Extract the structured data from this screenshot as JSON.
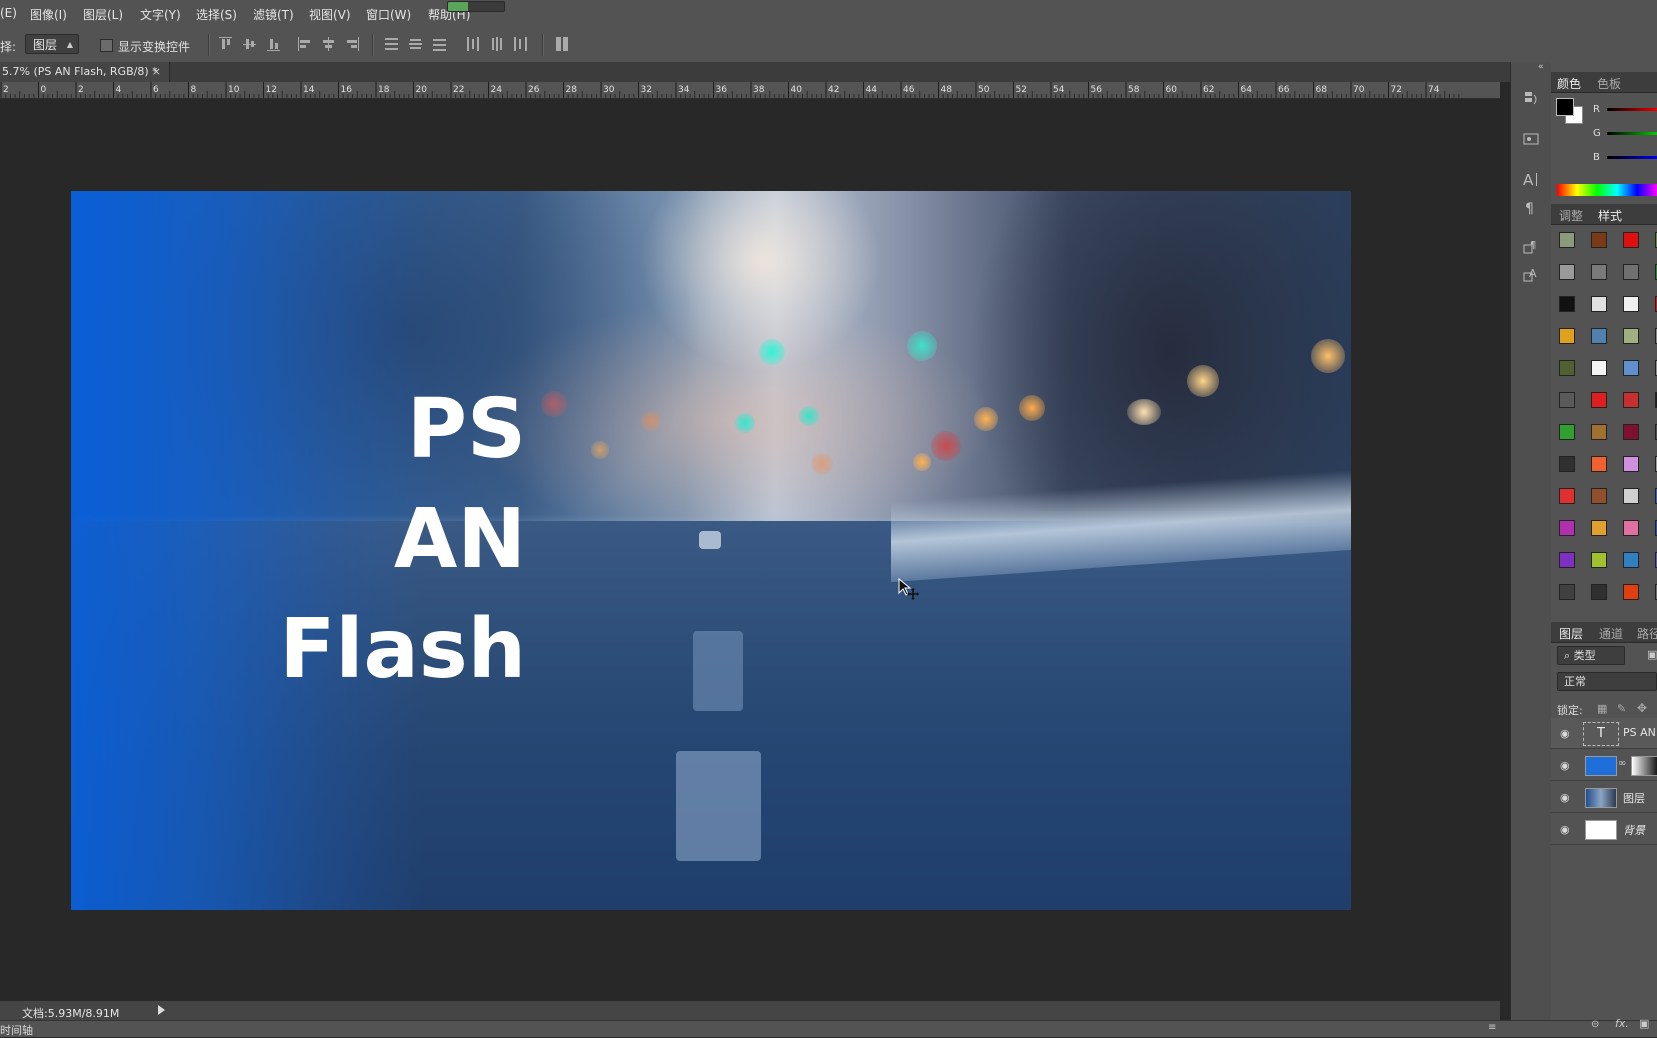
{
  "menu": {
    "items": [
      {
        "label": "(E)",
        "x_hint": "edit"
      },
      {
        "label": "图像(I)"
      },
      {
        "label": "图层(L)"
      },
      {
        "label": "文字(Y)"
      },
      {
        "label": "选择(S)"
      },
      {
        "label": "滤镜(T)"
      },
      {
        "label": "视图(V)"
      },
      {
        "label": "窗口(W)"
      },
      {
        "label": "帮助(H)"
      }
    ],
    "progress": 0.35
  },
  "options": {
    "select_prefix": "择:",
    "select_value": "图层",
    "transform_label": "显示变换控件"
  },
  "document": {
    "tab_title": "5.7% (PS AN Flash, RGB/8) *",
    "close": "×",
    "ruler_ticks": [
      "2",
      "0",
      "2",
      "4",
      "6",
      "8",
      "10",
      "12",
      "14",
      "16",
      "18",
      "20",
      "22",
      "24",
      "26",
      "28",
      "30",
      "32",
      "34",
      "36",
      "38",
      "40",
      "42",
      "44",
      "46",
      "48",
      "50",
      "52",
      "54",
      "56",
      "58",
      "60",
      "62",
      "64",
      "66",
      "68",
      "70",
      "72",
      "74"
    ],
    "status_doc": "文档:5.93M/8.91M"
  },
  "canvas_text": {
    "line1": "PS",
    "line2": "AN",
    "line3": "Flash"
  },
  "bottom": {
    "timeline_label": "时间轴"
  },
  "panels": {
    "color_tabs": [
      "颜色",
      "色板"
    ],
    "channels": [
      "R",
      "G",
      "B"
    ],
    "style_tabs": [
      "调整",
      "样式"
    ],
    "layer_tabs": [
      "图层",
      "通道",
      "路径"
    ],
    "filter_kind": "类型",
    "blend_mode": "正常",
    "lock_label": "锁定:",
    "layers": [
      {
        "name": "PS AN"
      },
      {
        "name": ""
      },
      {
        "name": "图层"
      },
      {
        "name": "背景"
      }
    ],
    "fx_label": "fx."
  },
  "colors": {
    "accent": "#1e6fd9",
    "panel": "#535353",
    "canvas_bg": "#282828"
  }
}
